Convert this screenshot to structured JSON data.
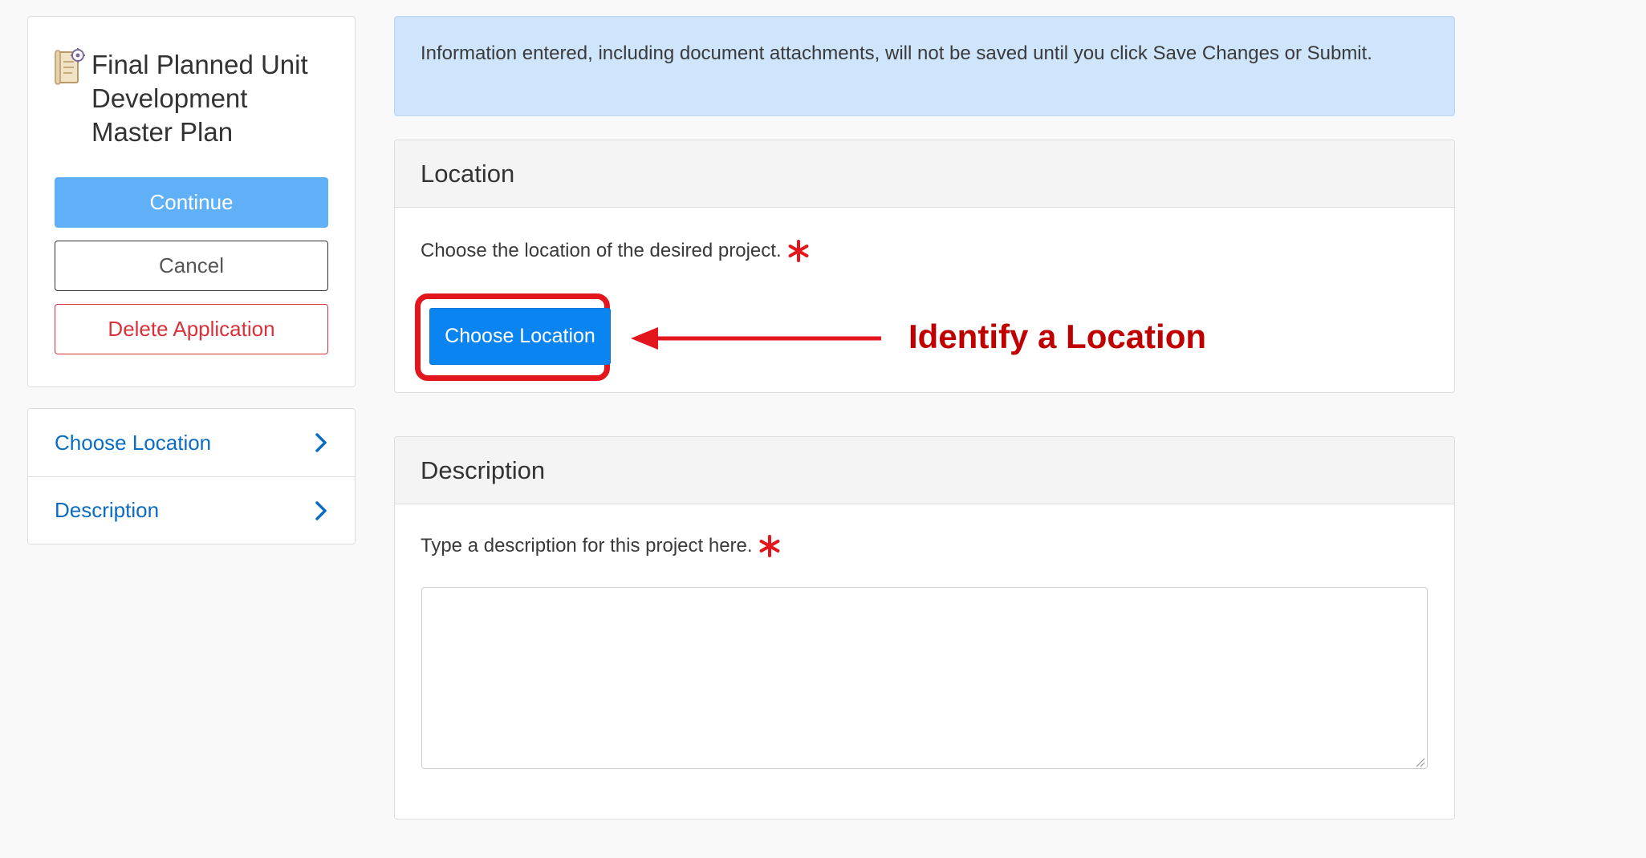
{
  "left": {
    "app_title": "Final Planned Unit Development Master Plan",
    "app_icon": "plan-document-gear-icon",
    "continue_label": "Continue",
    "cancel_label": "Cancel",
    "delete_label": "Delete Application"
  },
  "nav": {
    "items": [
      {
        "label": "Choose Location",
        "icon": "chevron-right-icon"
      },
      {
        "label": "Description",
        "icon": "chevron-right-icon"
      }
    ]
  },
  "banner": {
    "text": "Information entered, including document attachments, will not be saved until you click Save Changes or Submit."
  },
  "location": {
    "header": "Location",
    "prompt": "Choose the location of the desired project.",
    "button_label": "Choose Location"
  },
  "callout": {
    "text": "Identify a Location"
  },
  "description": {
    "header": "Description",
    "prompt": "Type a description for this project here.",
    "value": "",
    "placeholder": ""
  },
  "colors": {
    "link": "#0b6cc4",
    "primary": "#0a84f0",
    "continue": "#5fb0f6",
    "danger": "#d9323b",
    "required": "#e3161e",
    "callout": "#c00000",
    "banner_bg": "#cfe5fb"
  }
}
